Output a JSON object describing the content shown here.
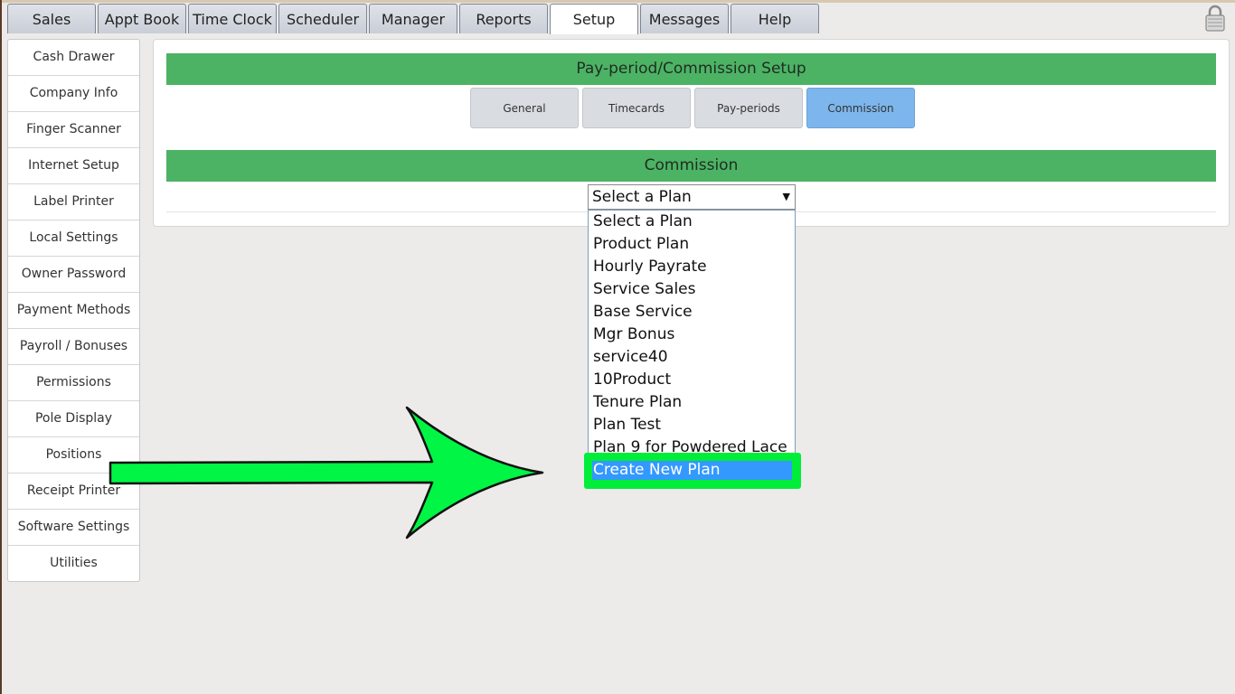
{
  "topnav": {
    "tabs": [
      {
        "label": "Sales"
      },
      {
        "label": "Appt Book"
      },
      {
        "label": "Time Clock"
      },
      {
        "label": "Scheduler"
      },
      {
        "label": "Manager"
      },
      {
        "label": "Reports"
      },
      {
        "label": "Setup",
        "active": true
      },
      {
        "label": "Messages"
      },
      {
        "label": "Help"
      }
    ]
  },
  "sidebar": {
    "items": [
      {
        "label": "Cash Drawer"
      },
      {
        "label": "Company Info"
      },
      {
        "label": "Finger Scanner"
      },
      {
        "label": "Internet Setup"
      },
      {
        "label": "Label Printer"
      },
      {
        "label": "Local Settings"
      },
      {
        "label": "Owner Password"
      },
      {
        "label": "Payment Methods"
      },
      {
        "label": "Payroll / Bonuses"
      },
      {
        "label": "Permissions"
      },
      {
        "label": "Pole Display"
      },
      {
        "label": "Positions"
      },
      {
        "label": "Receipt Printer"
      },
      {
        "label": "Software Settings"
      },
      {
        "label": "Utilities"
      }
    ]
  },
  "main": {
    "section_title": "Pay-period/Commission Setup",
    "subtabs": [
      {
        "label": "General"
      },
      {
        "label": "Timecards"
      },
      {
        "label": "Pay-periods"
      },
      {
        "label": "Commission",
        "active": true
      }
    ],
    "commission_title": "Commission",
    "plan_select": {
      "selected": "Select a Plan",
      "options": [
        "Select a Plan",
        "Product Plan",
        "Hourly Payrate",
        "Service Sales",
        "Base Service",
        "Mgr Bonus",
        "service40",
        "10Product",
        "Tenure Plan",
        "Plan Test",
        "Plan 9 for Powdered Lace"
      ],
      "highlighted_option": "Create New Plan"
    }
  },
  "colors": {
    "section_bar": "#4cb364",
    "active_subtab": "#7db6ec",
    "highlight_box": "#00ee3a",
    "arrow_fill": "#00f544",
    "selected_option": "#3399ff"
  },
  "icons": {
    "lock": "lock-icon",
    "select_arrow": "triangle-down-icon",
    "pointer": "arrow-right-icon"
  }
}
